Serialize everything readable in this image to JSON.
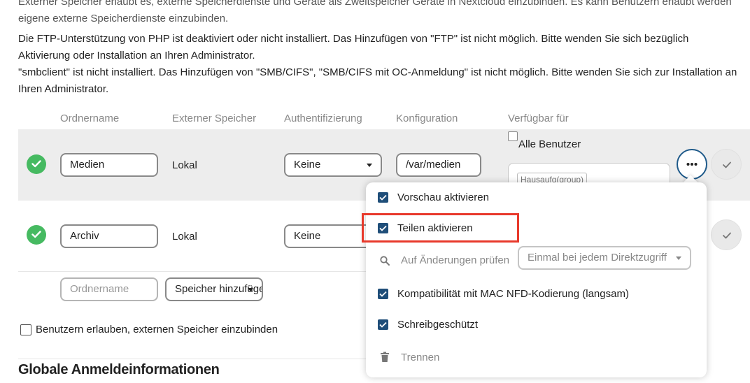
{
  "intro": {
    "line1": "Externer Speicher erlaubt es, externe Speicherdienste und Geräte als Zweitspeicher Geräte in Nextcloud einzubinden. Es kann Benutzern erlaubt werden",
    "line2": "eigene externe Speicherdienste einzubinden."
  },
  "warnings": {
    "ftp_line1": "Die FTP-Unterstützung von PHP ist deaktiviert oder nicht installiert. Das Hinzufügen von \"FTP\" ist nicht möglich. Bitte wenden Sie sich bezüglich",
    "ftp_line2": "Aktivierung oder Installation an Ihren Administrator.",
    "smb_line1": "\"smbclient\" ist nicht installiert. Das Hinzufügen von \"SMB/CIFS\", \"SMB/CIFS mit OC-Anmeldung\" ist nicht möglich. Bitte wenden Sie sich zur Installation an",
    "smb_line2": "Ihren Administrator."
  },
  "table": {
    "headers": {
      "folder_name": "Ordnername",
      "external_storage": "Externer Speicher",
      "authentication": "Authentifizierung",
      "configuration": "Konfiguration",
      "available_for": "Verfügbar für"
    },
    "rows": [
      {
        "folder_name": "Medien",
        "storage": "Lokal",
        "auth": "Keine",
        "config": "/var/medien",
        "all_users_label": "Alle Benutzer",
        "groups_placeholder": "Hausaufg(group)"
      },
      {
        "folder_name": "Archiv",
        "storage": "Lokal",
        "auth": "Keine"
      }
    ],
    "new_row": {
      "folder_placeholder": "Ordnername",
      "add_storage_label": "Speicher hinzufügen"
    }
  },
  "allow_users_label": "Benutzern erlauben, externen Speicher einzubinden",
  "menu": {
    "items": [
      {
        "label": "Vorschau aktivieren",
        "checked": true
      },
      {
        "label": "Teilen aktivieren",
        "checked": true
      },
      {
        "label": "Auf Änderungen prüfen",
        "select_value": "Einmal bei jedem Direktzugriff"
      },
      {
        "label": "Kompatibilität mit MAC NFD-Kodierung (langsam)",
        "checked": true
      },
      {
        "label": "Schreibgeschützt",
        "checked": true
      },
      {
        "label": "Trennen"
      }
    ]
  },
  "global_credentials_heading": "Globale Anmeldeinformationen",
  "colors": {
    "success": "#46ba61",
    "primary": "#1f4e79",
    "highlight": "#e8392b",
    "row_highlight": "#ededed"
  }
}
